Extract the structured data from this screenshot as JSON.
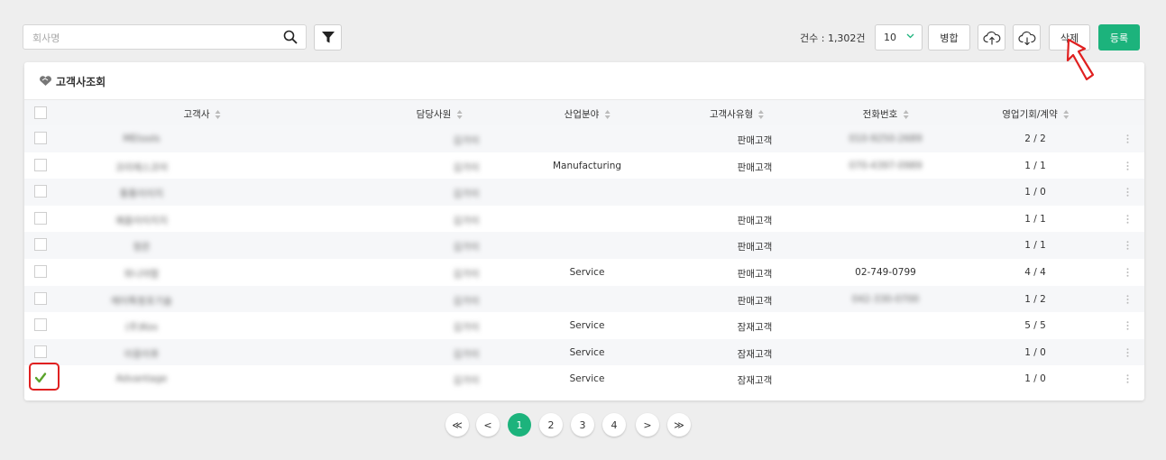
{
  "toolbar": {
    "search_placeholder": "회사명",
    "count_label": "건수 : 1,302건",
    "page_size": "10",
    "merge_label": "병합",
    "delete_label": "삭제",
    "register_label": "등록",
    "icons": {
      "search": "search-icon",
      "filter": "filter-icon",
      "upload": "cloud-upload-icon",
      "download": "cloud-download-icon",
      "chevron": "chevron-down-icon"
    }
  },
  "table": {
    "title": "고객사조회",
    "headers": [
      "고객사",
      "담당사원",
      "산업분야",
      "고객사유형",
      "전화번호",
      "영업기회/계약"
    ],
    "rows": [
      {
        "company": "MEtools",
        "staff": "김가이",
        "industry": "",
        "type": "판매고객",
        "phone": "010-9250-2689",
        "deals": "2 / 2",
        "checked": false
      },
      {
        "company": "코리에스코어",
        "staff": "김가이",
        "industry": "Manufacturing",
        "type": "판매고객",
        "phone": "070-4397-0989",
        "deals": "1 / 1",
        "checked": false
      },
      {
        "company": "통통이이지",
        "staff": "김가이",
        "industry": "",
        "type": "",
        "phone": "",
        "deals": "1 / 0",
        "checked": false
      },
      {
        "company": "쾌흡이이지지",
        "staff": "김가이",
        "industry": "",
        "type": "판매고객",
        "phone": "",
        "deals": "1 / 1",
        "checked": false
      },
      {
        "company": "정은",
        "staff": "김가이",
        "industry": "",
        "type": "판매고객",
        "phone": "",
        "deals": "1 / 1",
        "checked": false
      },
      {
        "company": "와니야함",
        "staff": "김가이",
        "industry": "Service",
        "type": "판매고객",
        "phone": "02-749-0799",
        "deals": "4 / 4",
        "checked": false
      },
      {
        "company": "에이특청포기술",
        "staff": "김가이",
        "industry": "",
        "type": "판매고객",
        "phone": "042-330-0700",
        "deals": "1 / 2",
        "checked": false
      },
      {
        "company": "(주)Kos",
        "staff": "김가이",
        "industry": "Service",
        "type": "잠재고객",
        "phone": "",
        "deals": "5 / 5",
        "checked": false
      },
      {
        "company": "이응이후",
        "staff": "김가이",
        "industry": "Service",
        "type": "잠재고객",
        "phone": "",
        "deals": "1 / 0",
        "checked": false
      },
      {
        "company": "Advantage",
        "staff": "김가이",
        "industry": "Service",
        "type": "잠재고객",
        "phone": "",
        "deals": "1 / 0",
        "checked": true
      }
    ]
  },
  "pagination": {
    "first": "≪",
    "prev": "<",
    "pages": [
      "1",
      "2",
      "3",
      "4"
    ],
    "current": "1",
    "next": ">",
    "last": "≫"
  },
  "colors": {
    "accent": "#1cb37c",
    "highlight": "#e02020",
    "check": "#5aa32a"
  }
}
